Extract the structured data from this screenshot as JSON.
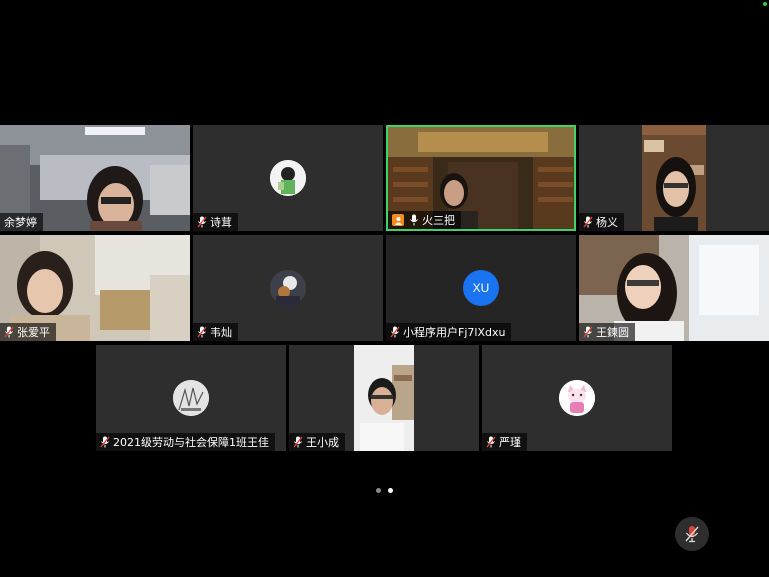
{
  "participants": [
    {
      "name": "余梦婷",
      "mic": "none"
    },
    {
      "name": "诗茸",
      "mic": "muted"
    },
    {
      "name": "火三把",
      "mic": "on",
      "host": true,
      "active": true
    },
    {
      "name": "杨义",
      "mic": "muted"
    },
    {
      "name": "张爱平",
      "mic": "muted"
    },
    {
      "name": "韦灿",
      "mic": "muted"
    },
    {
      "name": "小程序用户Fj7lXdxu",
      "mic": "muted",
      "avatar_text": "XU"
    },
    {
      "name": "王鍊圆",
      "mic": "muted"
    },
    {
      "name": "2021级劳动与社会保障1班王佳",
      "mic": "muted"
    },
    {
      "name": "王小成",
      "mic": "muted"
    },
    {
      "name": "严瑾",
      "mic": "muted"
    }
  ],
  "pagination": {
    "pages": 2,
    "current": 2
  },
  "colors": {
    "active_border": "#3fd26b",
    "host_badge": "#f28c1e",
    "avatar_blue": "#1a73f0",
    "mute_red": "#e0453a"
  },
  "icons": {
    "mic_muted": "mic-muted-icon",
    "mic_on": "mic-icon",
    "host": "host-person-icon",
    "mute_button": "microphone-slash-icon"
  }
}
